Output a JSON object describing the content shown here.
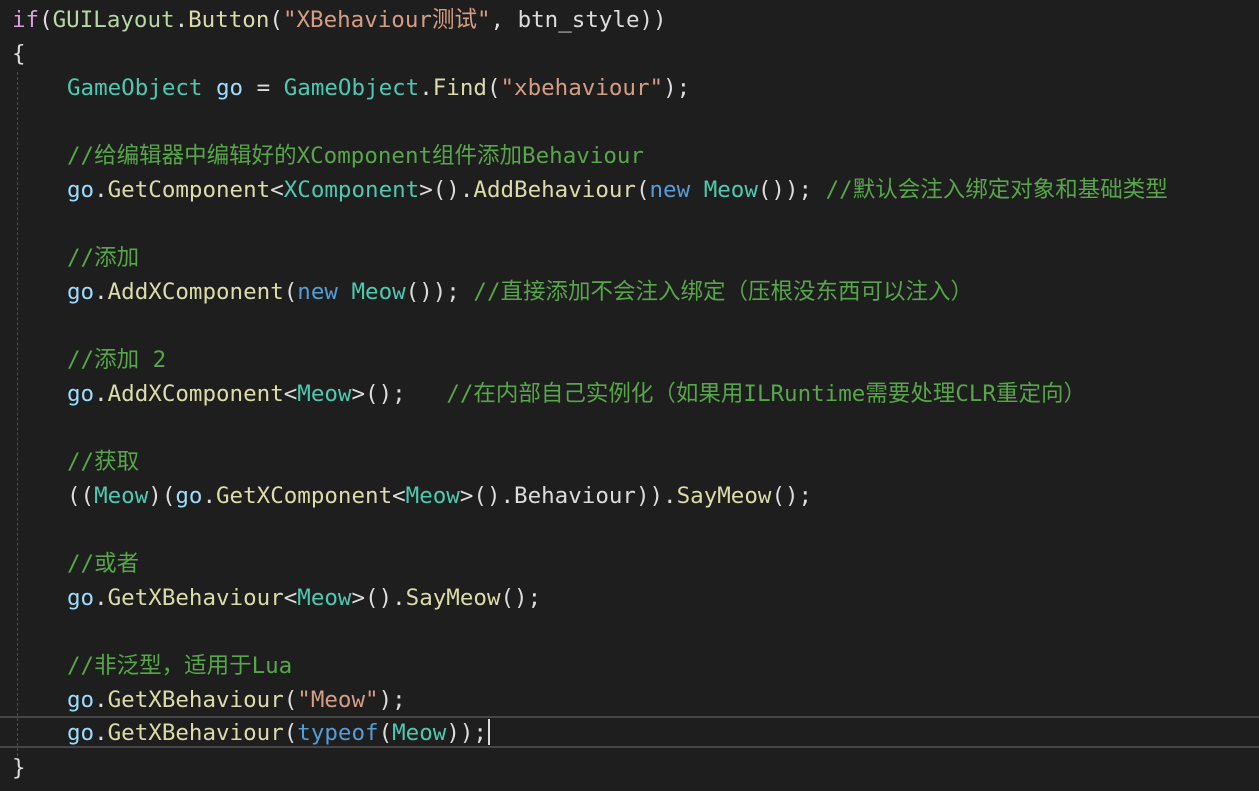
{
  "code": {
    "l1": {
      "kw_if": "if",
      "p1": "(",
      "cls": "GUILayout",
      "dot": ".",
      "method": "Button",
      "p2": "(",
      "str": "\"XBehaviour测试\"",
      "sep": ", ",
      "arg": "btn_style",
      "p3": "))"
    },
    "l2": {
      "brace": "{"
    },
    "l3": {
      "type": "GameObject",
      "sp": " ",
      "var": "go",
      "eq": " = ",
      "cls": "GameObject",
      "dot": ".",
      "method": "Find",
      "p1": "(",
      "str": "\"xbehaviour\"",
      "p2": ");"
    },
    "l5": {
      "comment": "//给编辑器中编辑好的XComponent组件添加Behaviour"
    },
    "l6": {
      "var": "go",
      "dot": ".",
      "method": "GetComponent",
      "lt": "<",
      "type": "XComponent",
      "gt": ">",
      "p1": "().",
      "method2": "AddBehaviour",
      "p2": "(",
      "kw_new": "new",
      "sp": " ",
      "type2": "Meow",
      "p3": "()); ",
      "comment": "//默认会注入绑定对象和基础类型"
    },
    "l8": {
      "comment": "//添加"
    },
    "l9": {
      "var": "go",
      "dot": ".",
      "method": "AddXComponent",
      "p1": "(",
      "kw_new": "new",
      "sp": " ",
      "type": "Meow",
      "p2": "()); ",
      "comment": "//直接添加不会注入绑定（压根没东西可以注入）"
    },
    "l11": {
      "comment": "//添加 2"
    },
    "l12": {
      "var": "go",
      "dot": ".",
      "method": "AddXComponent",
      "lt": "<",
      "type": "Meow",
      "gt": ">",
      "p1": "();   ",
      "comment": "//在内部自己实例化（如果用ILRuntime需要处理CLR重定向）"
    },
    "l14": {
      "comment": "//获取"
    },
    "l15": {
      "p1": "((",
      "type": "Meow",
      "p2": ")(",
      "var": "go",
      "dot": ".",
      "method": "GetXComponent",
      "lt": "<",
      "type2": "Meow",
      "gt": ">",
      "p3": "().",
      "prop": "Behaviour",
      "p4": ")).",
      "method2": "SayMeow",
      "p5": "();"
    },
    "l17": {
      "comment": "//或者"
    },
    "l18": {
      "var": "go",
      "dot": ".",
      "method": "GetXBehaviour",
      "lt": "<",
      "type": "Meow",
      "gt": ">",
      "p1": "().",
      "method2": "SayMeow",
      "p2": "();"
    },
    "l20": {
      "comment": "//非泛型，适用于Lua"
    },
    "l21": {
      "var": "go",
      "dot": ".",
      "method": "GetXBehaviour",
      "p1": "(",
      "str": "\"Meow\"",
      "p2": ");"
    },
    "l22": {
      "var": "go",
      "dot": ".",
      "method": "GetXBehaviour",
      "p1": "(",
      "kw_typeof": "typeof",
      "p2": "(",
      "type": "Meow",
      "p3": "));"
    },
    "l23": {
      "brace": "}"
    }
  },
  "colors": {
    "background": "#1e1e1e",
    "keyword_control": "#d8a0df",
    "keyword": "#569cd6",
    "type": "#4ec9b0",
    "method": "#dcdcaa",
    "variable": "#9cdcfe",
    "string": "#d69d85",
    "comment": "#57a64a",
    "punctuation": "#dcdcdc"
  }
}
